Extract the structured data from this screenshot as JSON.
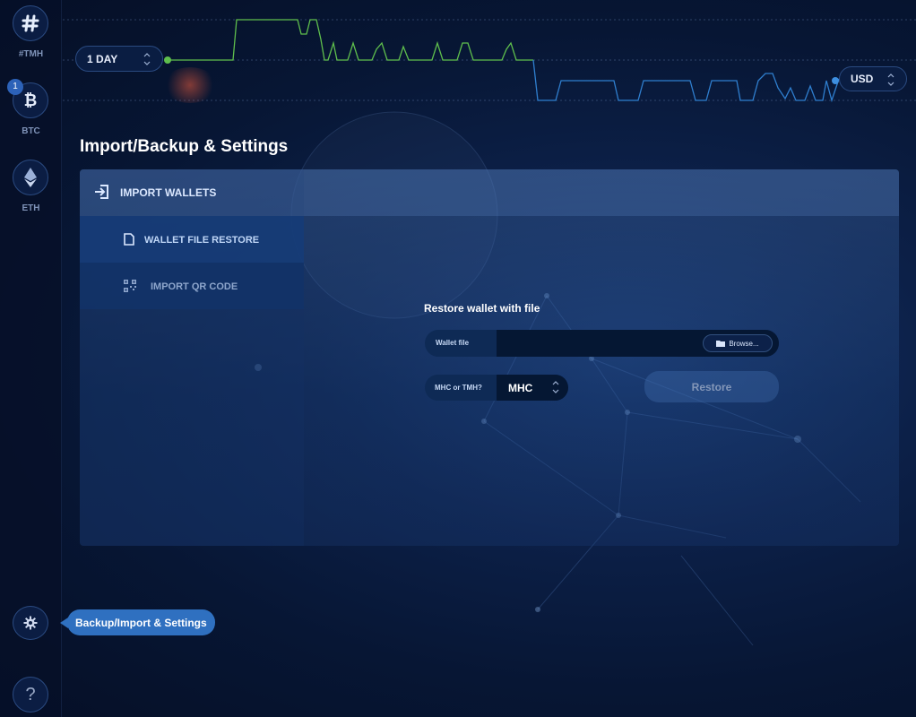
{
  "sidebar": {
    "coins": [
      {
        "label": "#TMH",
        "icon": "hashtag-icon"
      },
      {
        "label": "BTC",
        "icon": "bitcoin-icon",
        "badge": "1"
      },
      {
        "label": "ETH",
        "icon": "ethereum-icon"
      }
    ],
    "settings_icon": "gear-icon",
    "help_label": "?"
  },
  "chart": {
    "period": "1 DAY",
    "currency": "USD",
    "colors": {
      "up": "#5fbf4d",
      "down": "#2f7fcf"
    }
  },
  "page": {
    "title": "Import/Backup & Settings"
  },
  "panel": {
    "header": "IMPORT WALLETS",
    "menu": [
      {
        "label": "WALLET FILE RESTORE",
        "active": true
      },
      {
        "label": "IMPORT QR CODE",
        "active": false
      }
    ],
    "form": {
      "title": "Restore wallet with file",
      "wallet_file_label": "Wallet file",
      "wallet_file_value": "",
      "browse_label": "Browse...",
      "type_label": "MHC or TMH?",
      "type_value": "MHC",
      "restore_label": "Restore"
    }
  },
  "tooltip": "Backup/Import & Settings"
}
